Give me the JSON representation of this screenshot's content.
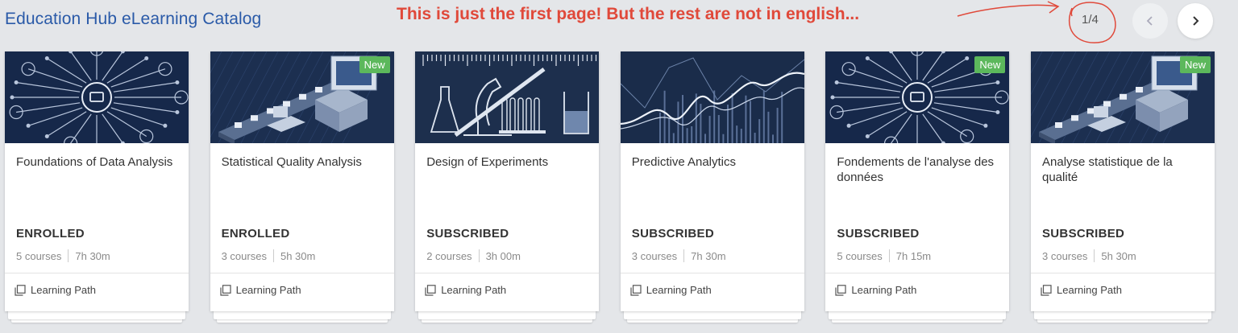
{
  "header": {
    "title": "Education Hub eLearning Catalog",
    "annotation": "This is just the first page! But the rest are not in english...",
    "pager": "1/4"
  },
  "colors": {
    "title": "#2a5aa8",
    "annotation": "#e0493a",
    "badge": "#5cb85c"
  },
  "cards": [
    {
      "title": "Foundations of Data Analysis",
      "badge": "",
      "status": "ENROLLED",
      "courses": "5 courses",
      "duration": "7h 30m",
      "type": "Learning Path",
      "image": "network"
    },
    {
      "title": "Statistical Quality Analysis",
      "badge": "New",
      "status": "ENROLLED",
      "courses": "3 courses",
      "duration": "5h 30m",
      "type": "Learning Path",
      "image": "factory"
    },
    {
      "title": "Design of Experiments",
      "badge": "",
      "status": "SUBSCRIBED",
      "courses": "2 courses",
      "duration": "3h 00m",
      "type": "Learning Path",
      "image": "lab"
    },
    {
      "title": "Predictive Analytics",
      "badge": "",
      "status": "SUBSCRIBED",
      "courses": "3 courses",
      "duration": "7h 30m",
      "type": "Learning Path",
      "image": "chart"
    },
    {
      "title": "Fondements de l'analyse des données",
      "badge": "New",
      "status": "SUBSCRIBED",
      "courses": "5 courses",
      "duration": "7h 15m",
      "type": "Learning Path",
      "image": "network"
    },
    {
      "title": "Analyse statistique de la qualité",
      "badge": "New",
      "status": "SUBSCRIBED",
      "courses": "3 courses",
      "duration": "5h 30m",
      "type": "Learning Path",
      "image": "factory"
    }
  ]
}
